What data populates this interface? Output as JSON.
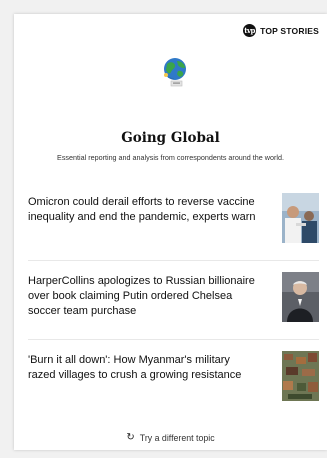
{
  "badge": {
    "logo_text": "tvp",
    "label": "TOP STORIES"
  },
  "section": {
    "icon": "globe-illustration-icon",
    "title": "Going Global",
    "subtitle": "Essential reporting and analysis from correspondents around the world."
  },
  "stories": [
    {
      "headline": "Omicron could derail efforts to reverse vaccine inequality and end the pandemic, experts warn",
      "thumb": "vaccination-photo"
    },
    {
      "headline": "HarperCollins apologizes to Russian billionaire over book claiming Putin ordered Chelsea soccer team purchase",
      "thumb": "billionaire-portrait-photo"
    },
    {
      "headline": "'Burn it all down': How Myanmar's military razed villages to crush a growing resistance",
      "thumb": "burned-village-aerial-photo"
    }
  ],
  "footer": {
    "refresh_icon": "refresh-icon",
    "refresh_label": "Try a different topic"
  },
  "colors": {
    "background": "#f1f1f1",
    "card": "#ffffff",
    "text": "#111111",
    "divider": "#e8e8e8"
  }
}
